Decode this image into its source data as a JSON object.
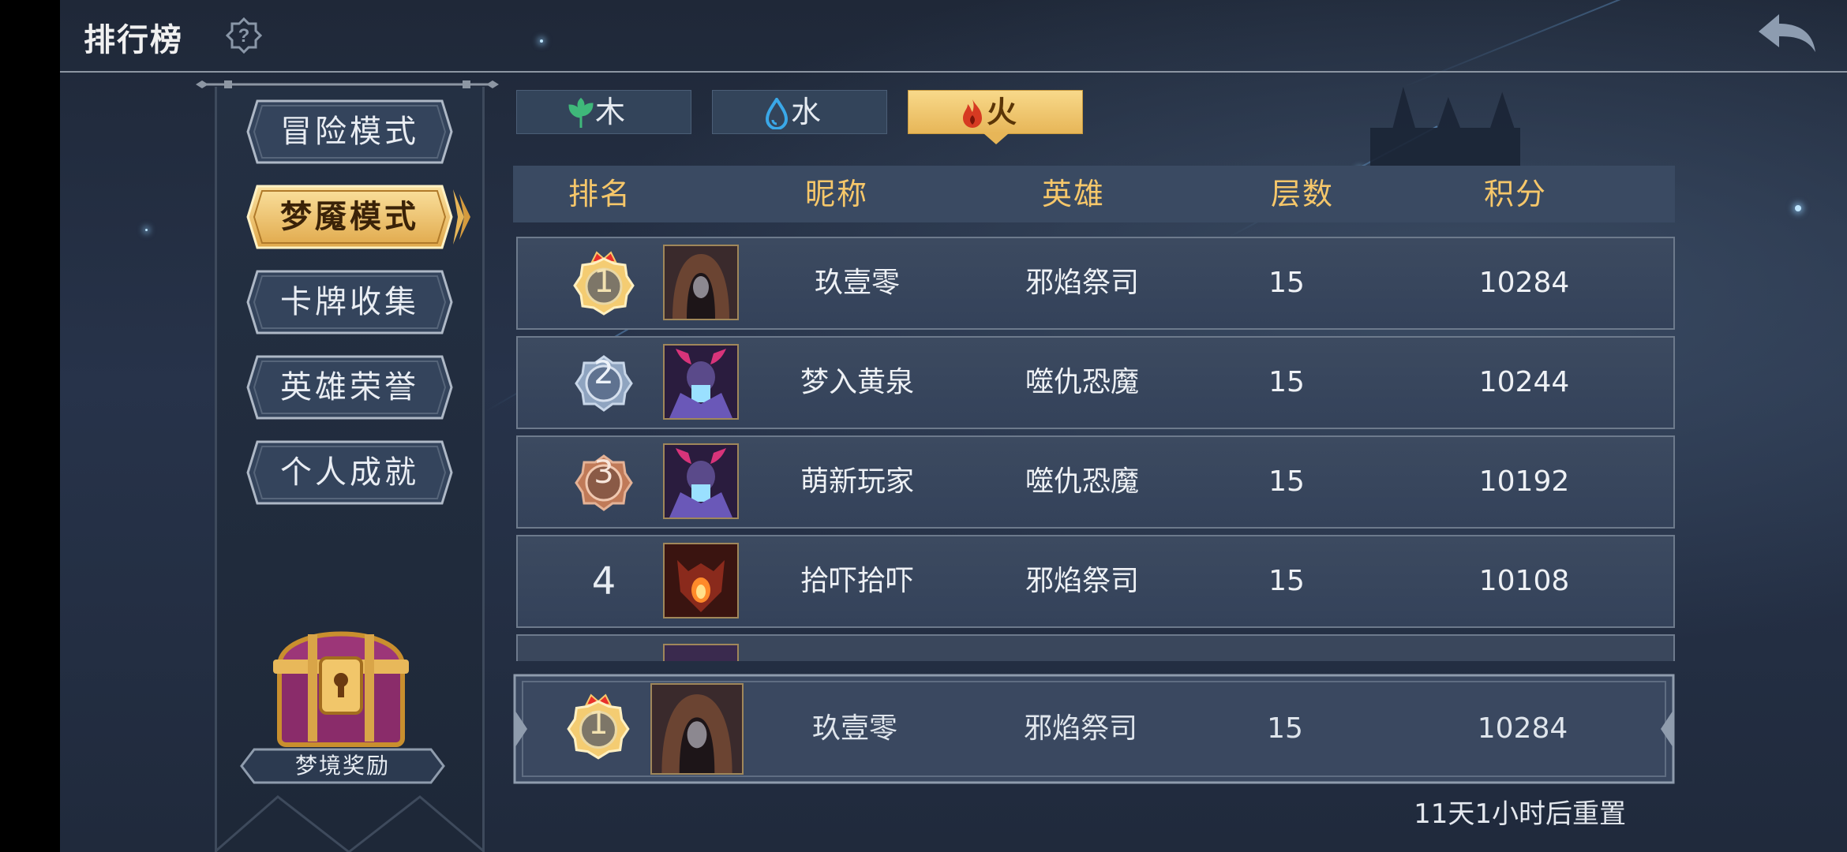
{
  "header": {
    "title": "排行榜"
  },
  "modes": [
    {
      "label": "冒险模式",
      "active": false
    },
    {
      "label": "梦魇模式",
      "active": true
    },
    {
      "label": "卡牌收集",
      "active": false
    },
    {
      "label": "英雄荣誉",
      "active": false
    },
    {
      "label": "个人成就",
      "active": false
    }
  ],
  "reward": {
    "label": "梦境奖励"
  },
  "tabs": [
    {
      "label": "木",
      "icon": "leaf-icon",
      "color": "#3fb87a",
      "active": false
    },
    {
      "label": "水",
      "icon": "water-drop-icon",
      "color": "#3aa8e8",
      "active": false
    },
    {
      "label": "火",
      "icon": "flame-icon",
      "color": "#d63a22",
      "active": true
    }
  ],
  "table": {
    "headers": [
      "排名",
      "昵称",
      "英雄",
      "层数",
      "积分"
    ],
    "rows": [
      {
        "rank": "1",
        "name": "玖壹零",
        "hero": "邪焰祭司",
        "floor": "15",
        "score": "10284"
      },
      {
        "rank": "2",
        "name": "梦入黄泉",
        "hero": "噬仇恐魔",
        "floor": "15",
        "score": "10244"
      },
      {
        "rank": "3",
        "name": "萌新玩家",
        "hero": "噬仇恐魔",
        "floor": "15",
        "score": "10192"
      },
      {
        "rank": "4",
        "name": "拾吓拾吓",
        "hero": "邪焰祭司",
        "floor": "15",
        "score": "10108"
      }
    ]
  },
  "my_entry": {
    "rank": "1",
    "name": "玖壹零",
    "hero": "邪焰祭司",
    "floor": "15",
    "score": "10284"
  },
  "footer": {
    "reset_text": "11天1小时后重置"
  },
  "colors": {
    "gold": "#f6c76a",
    "silver": "#8fa4c0",
    "bronze": "#c07a58",
    "background": "#222c3e"
  }
}
